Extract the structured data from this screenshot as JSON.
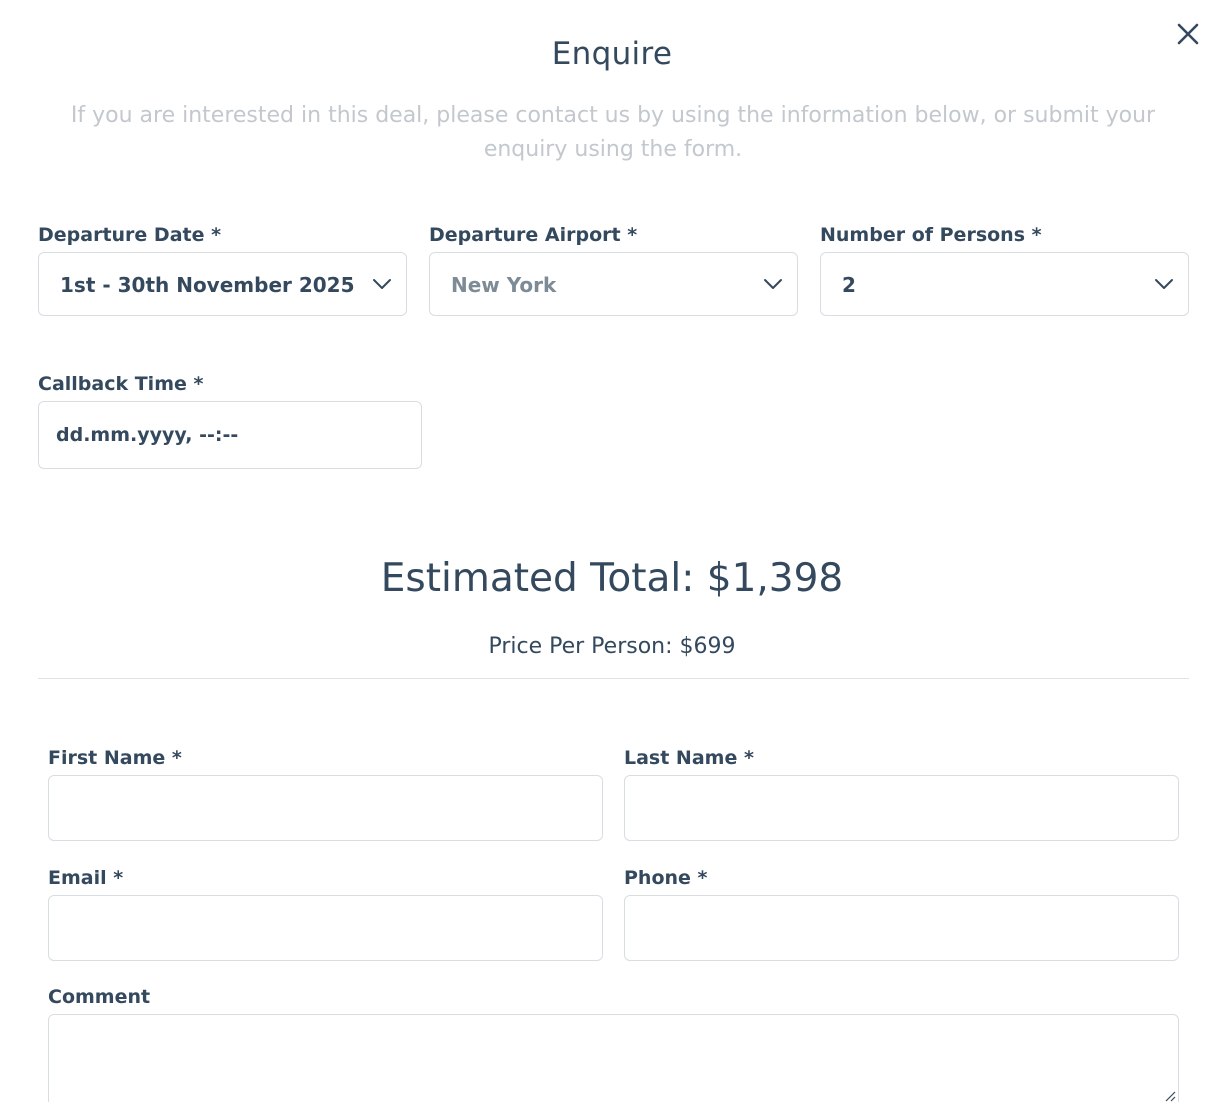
{
  "modal": {
    "title": "Enquire",
    "subtitle": "If you are interested in this deal, please contact us by using the information below, or submit your enquiry using the form."
  },
  "trip": {
    "departure_date": {
      "label": "Departure Date *",
      "value": "1st - 30th November 2025"
    },
    "departure_airport": {
      "label": "Departure Airport *",
      "value": "New York"
    },
    "persons": {
      "label": "Number of Persons *",
      "value": "2"
    },
    "callback": {
      "label": "Callback Time *",
      "placeholder": "dd.mm.yyyy, --:--"
    }
  },
  "pricing": {
    "total": "Estimated Total: $1,398",
    "per_person": "Price Per Person: $699"
  },
  "contact": {
    "first_name_label": "First Name *",
    "last_name_label": "Last Name *",
    "email_label": "Email *",
    "phone_label": "Phone *",
    "comment_label": "Comment"
  },
  "icons": {
    "close": "close-icon",
    "chevron": "chevron-down-icon",
    "resize": "resize-grip-icon"
  },
  "colors": {
    "text": "#34495e",
    "muted": "#c2c8cd",
    "border": "#d8dde1"
  }
}
